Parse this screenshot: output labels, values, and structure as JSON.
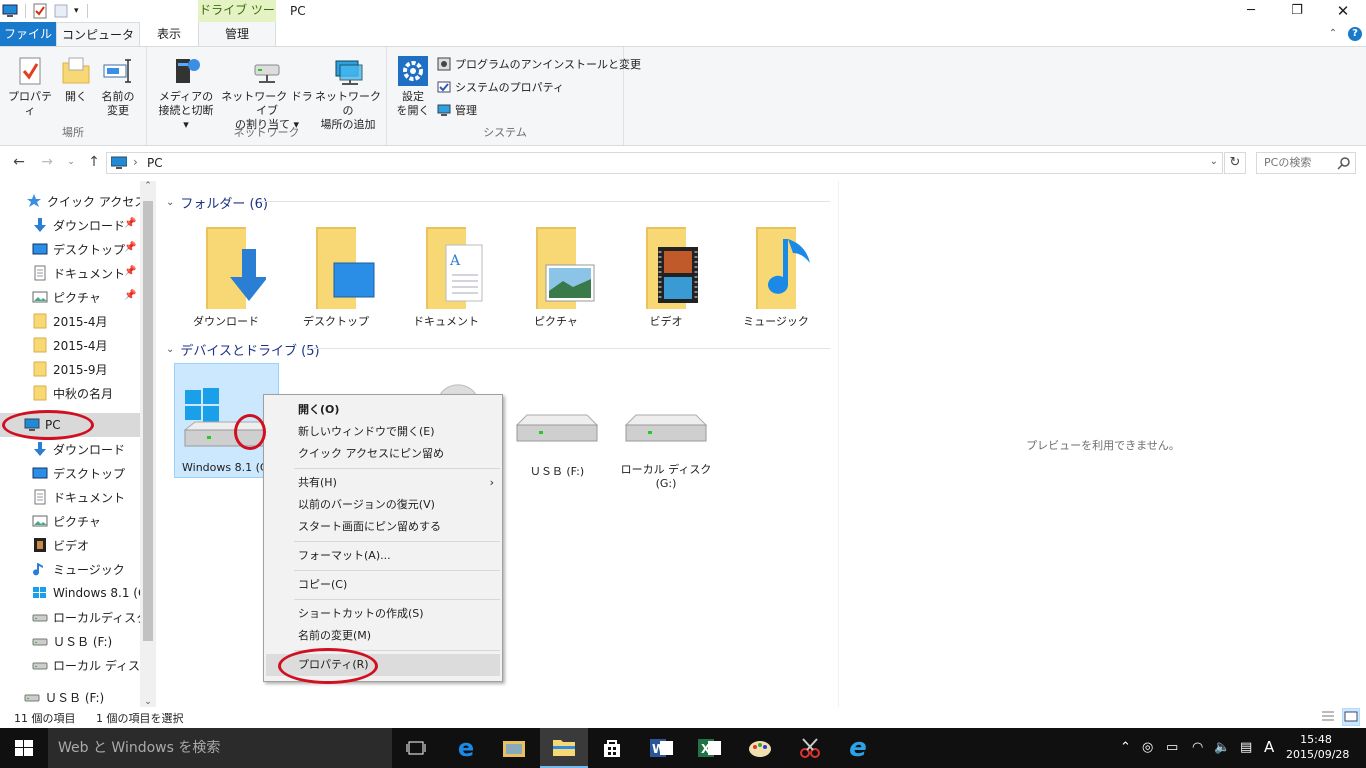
{
  "window": {
    "title": "PC",
    "context_tab_group": "ドライブ ツール"
  },
  "tabs": {
    "file": "ファイル",
    "computer": "コンピューター",
    "view": "表示",
    "manage": "管理"
  },
  "ribbon": {
    "groups": {
      "location": "場所",
      "network": "ネットワーク",
      "system": "システム"
    },
    "properties": "プロパティ",
    "open": "開く",
    "rename_l1": "名前の",
    "rename_l2": "変更",
    "media_l1": "メディアの",
    "media_l2": "接続と切断",
    "mapdrive_l1": "ネットワーク ドライブ",
    "mapdrive_l2": "の割り当て",
    "addloc_l1": "ネットワークの",
    "addloc_l2": "場所の追加",
    "settings_l1": "設定",
    "settings_l2": "を開く",
    "uninstall": "プログラムのアンインストールと変更",
    "sysprops": "システムのプロパティ",
    "manage": "管理"
  },
  "address": {
    "path": "PC",
    "search_placeholder": "PCの検索"
  },
  "nav": {
    "quick_access": "クイック アクセス",
    "qa_items": [
      "ダウンロード",
      "デスクトップ",
      "ドキュメント",
      "ピクチャ",
      "2015-4月",
      "2015-4月",
      "2015-9月",
      "中秋の名月"
    ],
    "pc": "PC",
    "pc_items": [
      "ダウンロード",
      "デスクトップ",
      "ドキュメント",
      "ピクチャ",
      "ビデオ",
      "ミュージック",
      "Windows 8.1 (C:)",
      "ローカルディスク (D:",
      "ＵＳＢ (F:)",
      "ローカル ディスク (G"
    ],
    "usb": "ＵＳＢ (F:)"
  },
  "content": {
    "folders_header": "フォルダー (6)",
    "folders": [
      "ダウンロード",
      "デスクトップ",
      "ドキュメント",
      "ピクチャ",
      "ビデオ",
      "ミュージック"
    ],
    "drives_header": "デバイスとドライブ (5)",
    "drive_c": "Windows 8.1 (C",
    "drive_f": "ＵＳＢ (F:)",
    "drive_g_l1": "ローカル ディスク",
    "drive_g_l2": "(G:)"
  },
  "context_menu": {
    "open": "開く(O)",
    "open_new_window": "新しいウィンドウで開く(E)",
    "pin_quick": "クイック アクセスにピン留め",
    "share": "共有(H)",
    "restore_prev": "以前のバージョンの復元(V)",
    "pin_start": "スタート画面にピン留めする",
    "format": "フォーマット(A)...",
    "copy": "コピー(C)",
    "create_shortcut": "ショートカットの作成(S)",
    "rename": "名前の変更(M)",
    "properties": "プロパティ(R)"
  },
  "preview": {
    "message": "プレビューを利用できません。"
  },
  "status": {
    "items": "11 個の項目",
    "selected": "1 個の項目を選択"
  },
  "taskbar": {
    "search": "Web と Windows を検索",
    "ime": "A",
    "time": "15:48",
    "date": "2015/09/28"
  },
  "colors": {
    "accent": "#1979ca",
    "selection": "#cce8ff",
    "annotation": "#d01020",
    "folder": "#f8d775"
  }
}
